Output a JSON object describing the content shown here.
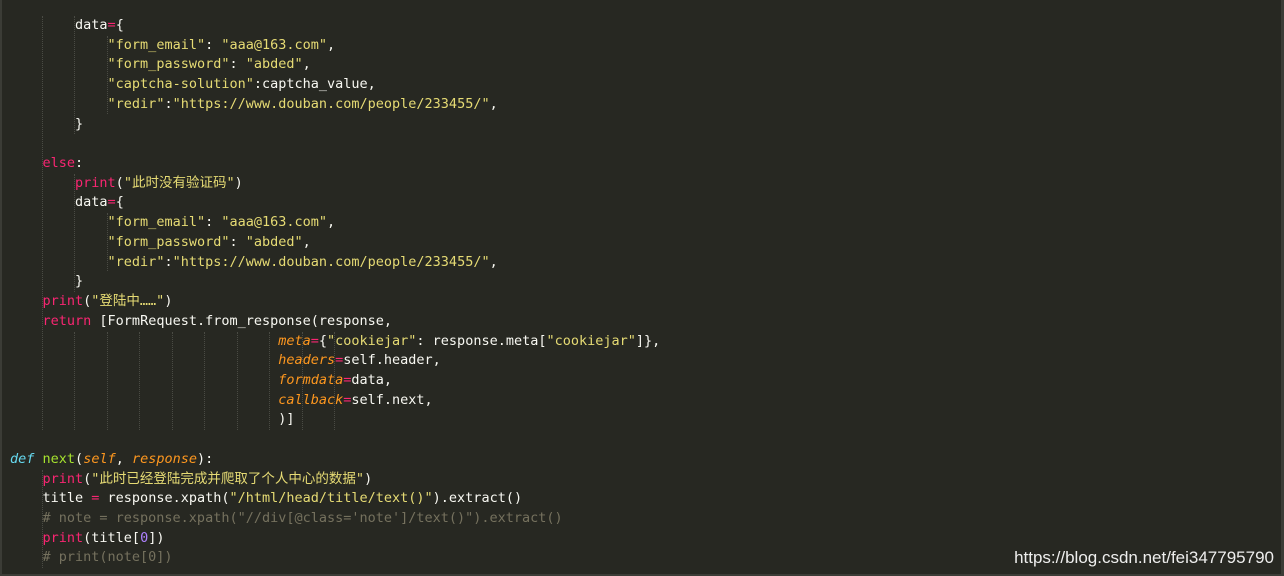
{
  "colors": {
    "background": "#272822",
    "text": "#f8f8f2",
    "keyword": "#f92672",
    "string": "#e6db74",
    "function": "#a6e22e",
    "def_keyword": "#66d9ef",
    "argument": "#fd971f",
    "number": "#ae81ff",
    "comment": "#75715e"
  },
  "code": {
    "lines": [
      [
        {
          "t": "p",
          "v": "        data"
        },
        {
          "t": "op",
          "v": "="
        },
        {
          "t": "p",
          "v": "{"
        }
      ],
      [
        {
          "t": "p",
          "v": "            "
        },
        {
          "t": "str",
          "v": "\"form_email\""
        },
        {
          "t": "p",
          "v": ": "
        },
        {
          "t": "str",
          "v": "\"aaa@163.com\""
        },
        {
          "t": "p",
          "v": ","
        }
      ],
      [
        {
          "t": "p",
          "v": "            "
        },
        {
          "t": "str",
          "v": "\"form_password\""
        },
        {
          "t": "p",
          "v": ": "
        },
        {
          "t": "str",
          "v": "\"abded\""
        },
        {
          "t": "p",
          "v": ","
        }
      ],
      [
        {
          "t": "p",
          "v": "            "
        },
        {
          "t": "str",
          "v": "\"captcha-solution\""
        },
        {
          "t": "p",
          "v": ":captcha_value,"
        }
      ],
      [
        {
          "t": "p",
          "v": "            "
        },
        {
          "t": "str",
          "v": "\"redir\""
        },
        {
          "t": "p",
          "v": ":"
        },
        {
          "t": "str",
          "v": "\"https://www.douban.com/people/233455/\""
        },
        {
          "t": "p",
          "v": ","
        }
      ],
      [
        {
          "t": "p",
          "v": "        }"
        }
      ],
      [
        {
          "t": "p",
          "v": ""
        }
      ],
      [
        {
          "t": "p",
          "v": "    "
        },
        {
          "t": "kw",
          "v": "else"
        },
        {
          "t": "p",
          "v": ":"
        }
      ],
      [
        {
          "t": "p",
          "v": "        "
        },
        {
          "t": "kw",
          "v": "print"
        },
        {
          "t": "p",
          "v": "("
        },
        {
          "t": "str",
          "v": "\"此时没有验证码\""
        },
        {
          "t": "p",
          "v": ")"
        }
      ],
      [
        {
          "t": "p",
          "v": "        data"
        },
        {
          "t": "op",
          "v": "="
        },
        {
          "t": "p",
          "v": "{"
        }
      ],
      [
        {
          "t": "p",
          "v": "            "
        },
        {
          "t": "str",
          "v": "\"form_email\""
        },
        {
          "t": "p",
          "v": ": "
        },
        {
          "t": "str",
          "v": "\"aaa@163.com\""
        },
        {
          "t": "p",
          "v": ","
        }
      ],
      [
        {
          "t": "p",
          "v": "            "
        },
        {
          "t": "str",
          "v": "\"form_password\""
        },
        {
          "t": "p",
          "v": ": "
        },
        {
          "t": "str",
          "v": "\"abded\""
        },
        {
          "t": "p",
          "v": ","
        }
      ],
      [
        {
          "t": "p",
          "v": "            "
        },
        {
          "t": "str",
          "v": "\"redir\""
        },
        {
          "t": "p",
          "v": ":"
        },
        {
          "t": "str",
          "v": "\"https://www.douban.com/people/233455/\""
        },
        {
          "t": "p",
          "v": ","
        }
      ],
      [
        {
          "t": "p",
          "v": "        }"
        }
      ],
      [
        {
          "t": "p",
          "v": "    "
        },
        {
          "t": "kw",
          "v": "print"
        },
        {
          "t": "p",
          "v": "("
        },
        {
          "t": "str",
          "v": "\"登陆中……\""
        },
        {
          "t": "p",
          "v": ")"
        }
      ],
      [
        {
          "t": "p",
          "v": "    "
        },
        {
          "t": "kw",
          "v": "return"
        },
        {
          "t": "p",
          "v": " [FormRequest.from_response(response,"
        }
      ],
      [
        {
          "t": "p",
          "v": "                                 "
        },
        {
          "t": "arg",
          "v": "meta"
        },
        {
          "t": "op",
          "v": "="
        },
        {
          "t": "p",
          "v": "{"
        },
        {
          "t": "str",
          "v": "\"cookiejar\""
        },
        {
          "t": "p",
          "v": ": response.meta["
        },
        {
          "t": "str",
          "v": "\"cookiejar\""
        },
        {
          "t": "p",
          "v": "]},"
        }
      ],
      [
        {
          "t": "p",
          "v": "                                 "
        },
        {
          "t": "arg",
          "v": "headers"
        },
        {
          "t": "op",
          "v": "="
        },
        {
          "t": "p",
          "v": "self.header,"
        }
      ],
      [
        {
          "t": "p",
          "v": "                                 "
        },
        {
          "t": "arg",
          "v": "formdata"
        },
        {
          "t": "op",
          "v": "="
        },
        {
          "t": "p",
          "v": "data,"
        }
      ],
      [
        {
          "t": "p",
          "v": "                                 "
        },
        {
          "t": "arg",
          "v": "callback"
        },
        {
          "t": "op",
          "v": "="
        },
        {
          "t": "p",
          "v": "self.next,"
        }
      ],
      [
        {
          "t": "p",
          "v": "                                 )]"
        }
      ],
      [
        {
          "t": "p",
          "v": ""
        }
      ],
      [
        {
          "t": "def",
          "v": "def"
        },
        {
          "t": "p",
          "v": " "
        },
        {
          "t": "fn",
          "v": "next"
        },
        {
          "t": "p",
          "v": "("
        },
        {
          "t": "arg",
          "v": "self"
        },
        {
          "t": "p",
          "v": ", "
        },
        {
          "t": "arg",
          "v": "response"
        },
        {
          "t": "p",
          "v": "):"
        }
      ],
      [
        {
          "t": "p",
          "v": "    "
        },
        {
          "t": "kw",
          "v": "print"
        },
        {
          "t": "p",
          "v": "("
        },
        {
          "t": "str",
          "v": "\"此时已经登陆完成并爬取了个人中心的数据\""
        },
        {
          "t": "p",
          "v": ")"
        }
      ],
      [
        {
          "t": "p",
          "v": "    title "
        },
        {
          "t": "op",
          "v": "="
        },
        {
          "t": "p",
          "v": " response.xpath("
        },
        {
          "t": "str",
          "v": "\"/html/head/title/text()\""
        },
        {
          "t": "p",
          "v": ").extract()"
        }
      ],
      [
        {
          "t": "cmt",
          "v": "    # note = response.xpath(\"//div[@class='note']/text()\").extract()"
        }
      ],
      [
        {
          "t": "p",
          "v": "    "
        },
        {
          "t": "kw",
          "v": "print"
        },
        {
          "t": "p",
          "v": "(title["
        },
        {
          "t": "num",
          "v": "0"
        },
        {
          "t": "p",
          "v": "])"
        }
      ],
      [
        {
          "t": "cmt",
          "v": "    # print(note[0])"
        }
      ]
    ]
  },
  "watermark": {
    "text": "https://blog.csdn.net/fei347795790"
  }
}
